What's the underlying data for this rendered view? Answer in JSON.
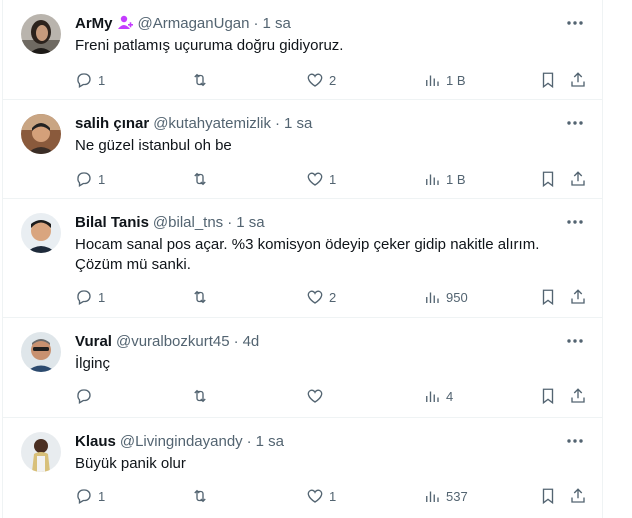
{
  "colors": {
    "text": "#0f1419",
    "muted": "#536471",
    "border": "#eff3f4",
    "badge": "#c43cff"
  },
  "tweets": [
    {
      "name": "ArMy",
      "badge": "person-badge-icon",
      "handle": "@ArmaganUgan",
      "time": "1 sa",
      "text": [
        "Freni patlamış uçuruma doğru gidiyoruz."
      ],
      "replies": "1",
      "retweets": "",
      "likes": "2",
      "views": "1 B"
    },
    {
      "name": "salih çınar",
      "badge": "",
      "handle": "@kutahyatemizlik",
      "time": "1 sa",
      "text": [
        "Ne güzel istanbul oh be"
      ],
      "replies": "1",
      "retweets": "",
      "likes": "1",
      "views": "1 B"
    },
    {
      "name": "Bilal Tanis",
      "badge": "",
      "handle": "@bilal_tns",
      "time": "1 sa",
      "text": [
        "Hocam sanal pos açar. %3 komisyon ödeyip çeker gidip nakitle alırım.",
        "Çözüm mü sanki."
      ],
      "replies": "1",
      "retweets": "",
      "likes": "2",
      "views": "950"
    },
    {
      "name": "Vural",
      "badge": "",
      "handle": "@vuralbozkurt45",
      "time": "4d",
      "text": [
        "İlginç"
      ],
      "replies": "",
      "retweets": "",
      "likes": "",
      "views": "4"
    },
    {
      "name": "Klaus",
      "badge": "",
      "handle": "@Livingindayandy",
      "time": "1 sa",
      "text": [
        "Büyük panik olur"
      ],
      "replies": "1",
      "retweets": "",
      "likes": "1",
      "views": "537"
    }
  ],
  "dot": "·"
}
